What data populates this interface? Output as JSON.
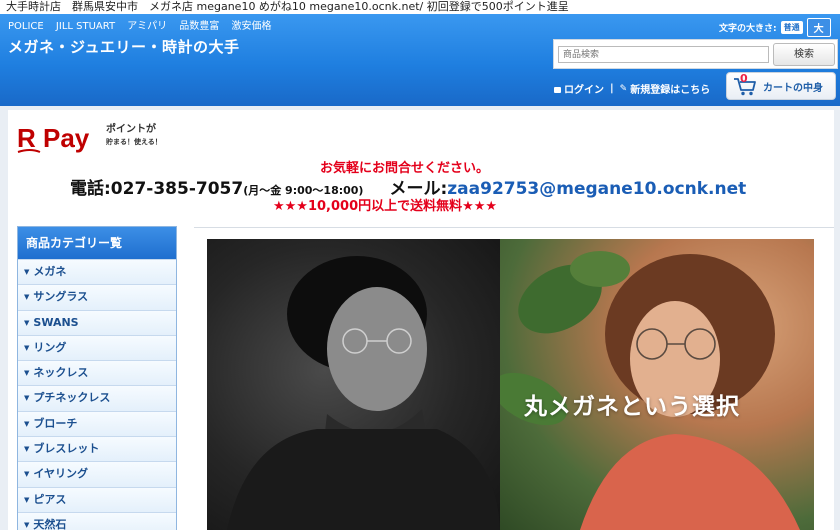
{
  "topbar": {
    "text": "大手時計店　群馬県安中市　メガネ店 megane10 めがね10 megane10.ocnk.net/ 初回登録で500ポイント進呈"
  },
  "header": {
    "brand_links": [
      "POLICE",
      "JILL STUART",
      "アミパリ",
      "品数豊富",
      "激安価格"
    ],
    "tagline": "メガネ・ジュエリー・時計の大手",
    "font_size": {
      "label": "文字の大きさ:",
      "normal": "普通",
      "large": "大"
    },
    "search": {
      "placeholder": "商品検索",
      "button": "検索"
    },
    "login": "ログイン",
    "register": "新規登録はこちら",
    "cart": {
      "count": "0",
      "label": "カートの中身"
    }
  },
  "rpay": {
    "logo": "R Pay",
    "line1": "ポイントが",
    "line2": "貯まる！使える！"
  },
  "contact": {
    "inquiry": "お気軽にお問合せください。",
    "phone_label": "電話:027-385-7057",
    "hours": "(月〜金 9:00〜18:00)",
    "mail_label": "メール:",
    "mail": "zaa92753@megane10.ocnk.net",
    "shipping": "★★★10,000円以上で送料無料★★★"
  },
  "sidebar": {
    "title": "商品カテゴリー覧",
    "items": [
      {
        "label": "メガネ"
      },
      {
        "label": "サングラス"
      },
      {
        "label": "SWANS"
      },
      {
        "label": "リング"
      },
      {
        "label": "ネックレス"
      },
      {
        "label": "プチネックレス"
      },
      {
        "label": "ブローチ"
      },
      {
        "label": "ブレスレット"
      },
      {
        "label": "イヤリング"
      },
      {
        "label": "ピアス"
      },
      {
        "label": "天然石"
      }
    ]
  },
  "banner": {
    "text": "丸メガネという選択"
  },
  "colors": {
    "header_blue": "#1f7fe0",
    "accent_red": "#e4001b",
    "link_blue": "#1a5db5",
    "rpay_red": "#bf0000"
  }
}
